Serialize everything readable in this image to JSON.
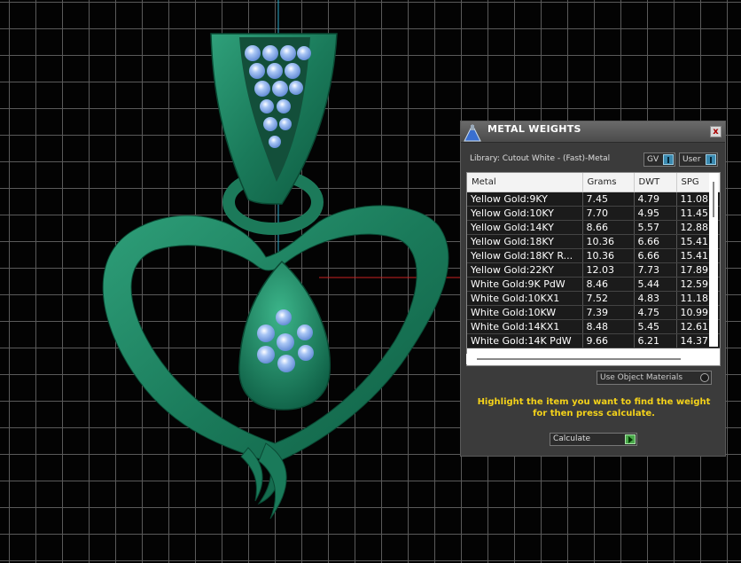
{
  "panel": {
    "title": "METAL WEIGHTS",
    "close_glyph": "x",
    "library_label": "Library: Cutout White - (Fast)-Metal",
    "toggles": {
      "gv": "GV",
      "user": "User"
    },
    "columns": [
      "Metal",
      "Grams",
      "DWT",
      "SPG"
    ],
    "rows": [
      [
        "Yellow Gold:9KY",
        "7.45",
        "4.79",
        "11.08"
      ],
      [
        "Yellow Gold:10KY",
        "7.70",
        "4.95",
        "11.45"
      ],
      [
        "Yellow Gold:14KY",
        "8.66",
        "5.57",
        "12.88"
      ],
      [
        "Yellow Gold:18KY",
        "10.36",
        "6.66",
        "15.41"
      ],
      [
        "Yellow Gold:18KY R...",
        "10.36",
        "6.66",
        "15.41"
      ],
      [
        "Yellow Gold:22KY",
        "12.03",
        "7.73",
        "17.89"
      ],
      [
        "White Gold:9K PdW",
        "8.46",
        "5.44",
        "12.59"
      ],
      [
        "White Gold:10KX1",
        "7.52",
        "4.83",
        "11.18"
      ],
      [
        "White Gold:10KW",
        "7.39",
        "4.75",
        "10.99"
      ],
      [
        "White Gold:14KX1",
        "8.48",
        "5.45",
        "12.61"
      ],
      [
        "White Gold:14K PdW",
        "9.66",
        "6.21",
        "14.37"
      ]
    ],
    "use_object_materials": "Use Object Materials",
    "instructions": "Highlight the item you want to find the weight for then press calculate.",
    "calculate_label": "Calculate"
  },
  "viewport": {
    "model": "heart-pendant",
    "model_color": "#1a7a5a",
    "gem_color": "#8fb4ee",
    "axis_colors": {
      "vertical": "#2aa8c8",
      "horizontal": "#c82020"
    }
  }
}
